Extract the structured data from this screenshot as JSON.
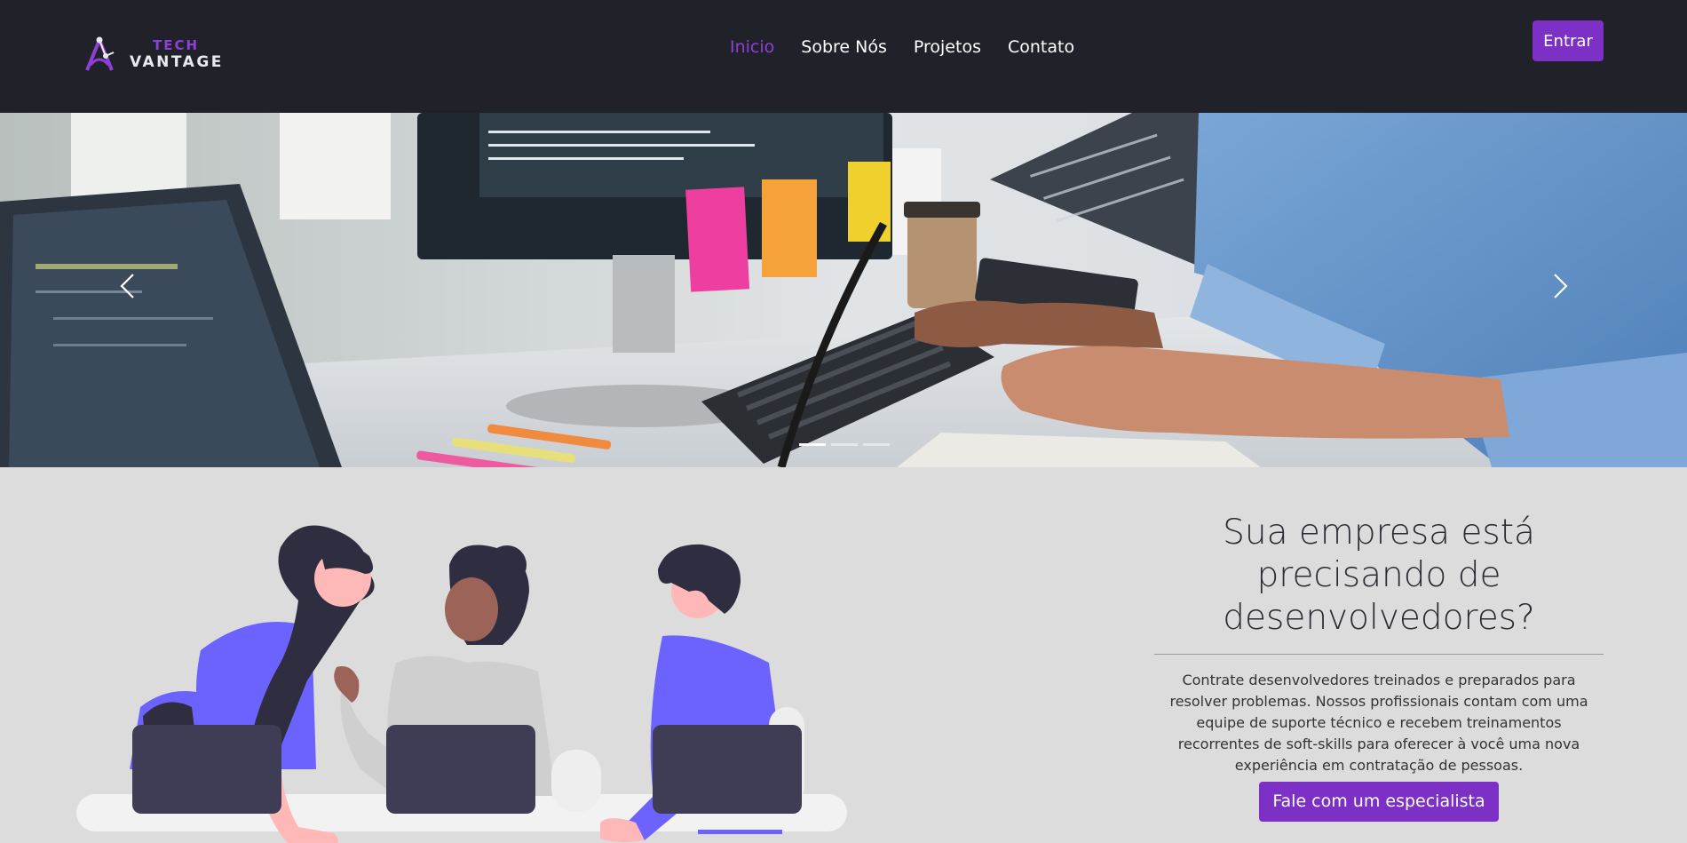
{
  "brand": {
    "line1": "TECH",
    "line2": "VANTAGE",
    "accent": "#8e3fd6"
  },
  "nav": {
    "items": [
      {
        "label": "Inicio",
        "active": true
      },
      {
        "label": "Sobre Nós",
        "active": false
      },
      {
        "label": "Projetos",
        "active": false
      },
      {
        "label": "Contato",
        "active": false
      }
    ],
    "login_label": "Entrar"
  },
  "hero": {
    "prev_icon": "chevron-left-icon",
    "next_icon": "chevron-right-icon",
    "slide_count": 3,
    "active_slide": 1
  },
  "promo": {
    "title": "Sua empresa está precisando de desenvolvedores?",
    "text": "Contrate desenvolvedores treinados e preparados para resolver problemas. Nossos profissionais contam com uma equipe de suporte técnico e recebem treinamentos recorrentes de soft-skills para oferecer à você uma nova experiência em contratação de pessoas.",
    "cta_label": "Fale com um especialista"
  },
  "colors": {
    "nav_bg": "#212229",
    "primary": "#7c30c5",
    "section_bg": "#dcdcdc"
  }
}
